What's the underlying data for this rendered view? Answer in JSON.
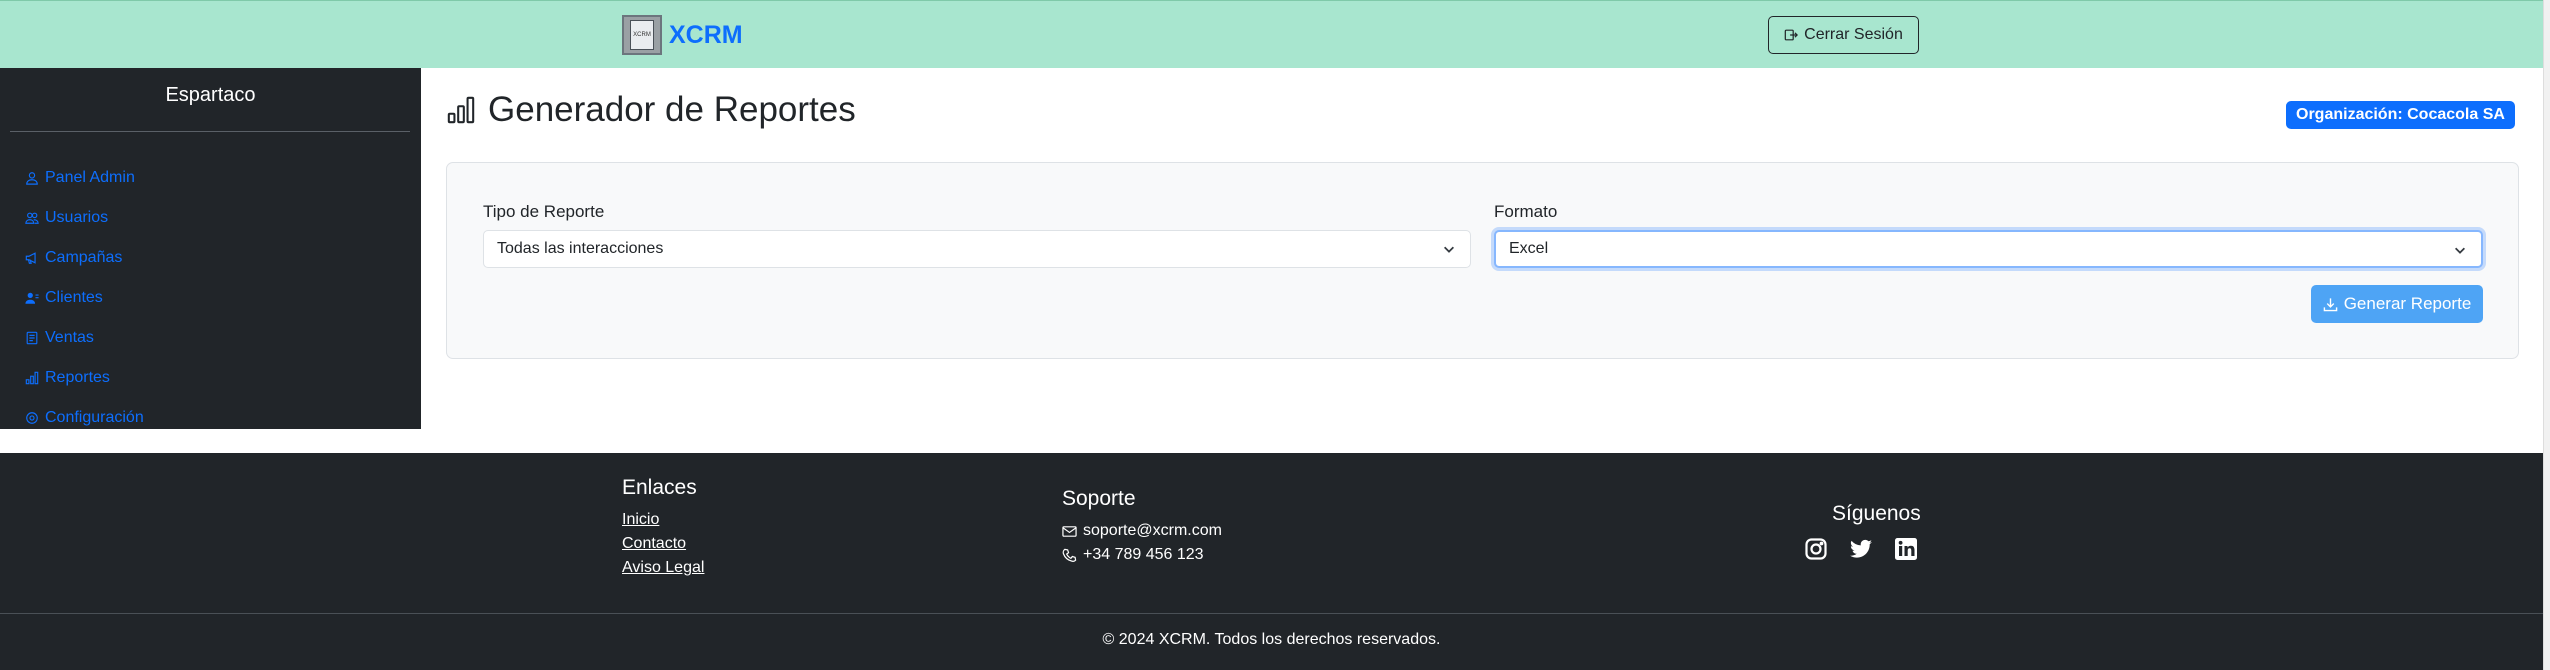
{
  "header": {
    "brand_name": "XCRM",
    "logo_text": "XCRM",
    "logout_label": "Cerrar Sesión"
  },
  "sidebar": {
    "user_name": "Espartaco",
    "items": [
      {
        "label": "Panel Admin",
        "icon": "person-icon"
      },
      {
        "label": "Usuarios",
        "icon": "people-icon"
      },
      {
        "label": "Campañas",
        "icon": "megaphone-icon"
      },
      {
        "label": "Clientes",
        "icon": "person-lines-icon"
      },
      {
        "label": "Ventas",
        "icon": "receipt-icon"
      },
      {
        "label": "Reportes",
        "icon": "bar-chart-icon"
      },
      {
        "label": "Configuración",
        "icon": "gear-icon"
      }
    ]
  },
  "main": {
    "title": "Generador de Reportes",
    "org_badge": "Organización: Cocacola SA",
    "form": {
      "report_type_label": "Tipo de Reporte",
      "report_type_value": "Todas las interacciones",
      "format_label": "Formato",
      "format_value": "Excel",
      "generate_label": "Generar Reporte"
    }
  },
  "footer": {
    "links_title": "Enlaces",
    "links": [
      "Inicio",
      "Contacto",
      "Aviso Legal"
    ],
    "support_title": "Soporte",
    "support_email": "soporte@xcrm.com",
    "support_phone": "+34 789 456 123",
    "social_title": "Síguenos",
    "copyright": "© 2024 XCRM. Todos los derechos reservados."
  },
  "colors": {
    "header_bg": "#a8e6cf",
    "sidebar_bg": "#212529",
    "accent": "#0d6efd",
    "button": "#4ea4f5"
  }
}
